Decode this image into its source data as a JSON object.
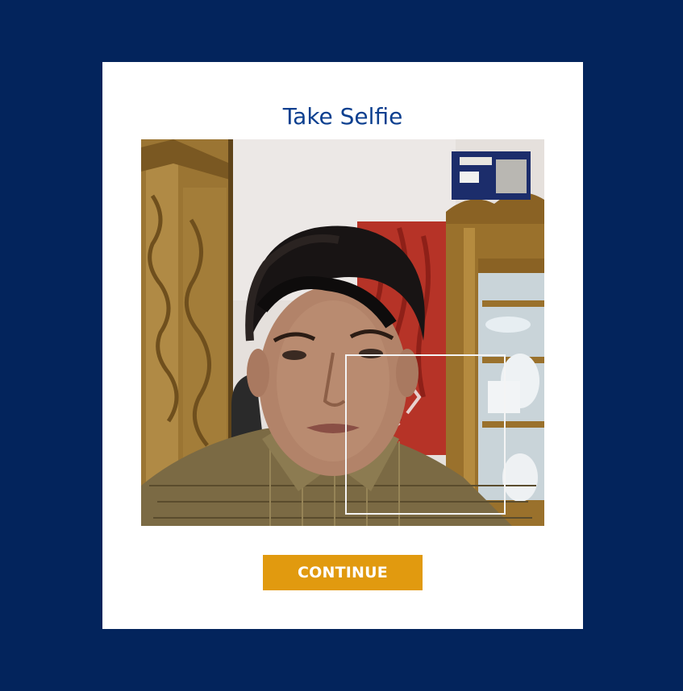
{
  "dialog": {
    "title": "Take Selfie",
    "continue_label": "CONTINUE"
  },
  "camera": {
    "face_detection_box": true
  },
  "colors": {
    "background": "#03245c",
    "card": "#ffffff",
    "title": "#0c3f8f",
    "button": "#e19a0f",
    "button_text": "#ffffff"
  }
}
